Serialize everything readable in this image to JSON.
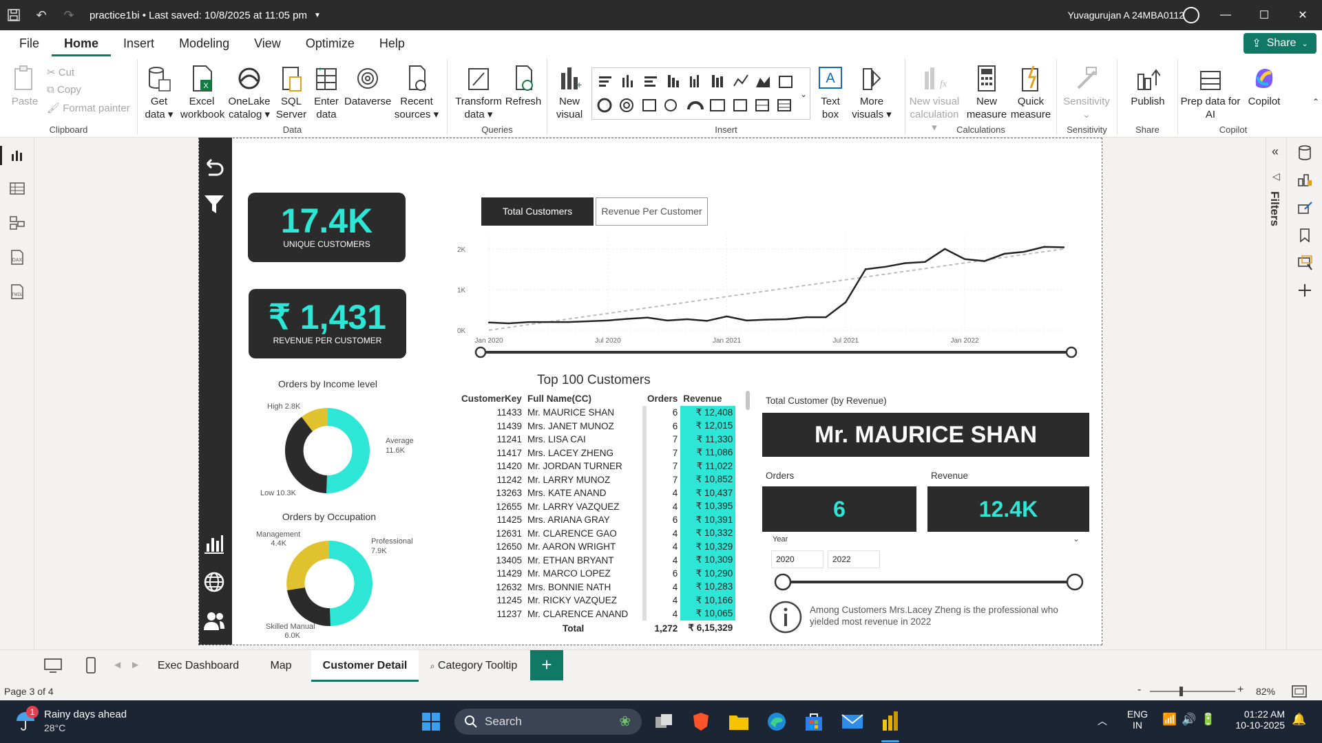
{
  "titlebar": {
    "title": "practice1bi • Last saved: 10/8/2025 at 11:05 pm",
    "user": "Yuvagurujan A 24MBA0112"
  },
  "menu": {
    "tabs": [
      "File",
      "Home",
      "Insert",
      "Modeling",
      "View",
      "Optimize",
      "Help"
    ],
    "active": "Home",
    "share": "Share"
  },
  "ribbon": {
    "clipboard": {
      "paste": "Paste",
      "cut": "Cut",
      "copy": "Copy",
      "format_painter": "Format painter",
      "group": "Clipboard"
    },
    "data": {
      "get_data": "Get data",
      "excel": "Excel workbook",
      "onelake": "OneLake catalog",
      "sql": "SQL Server",
      "enter": "Enter data",
      "dataverse": "Dataverse",
      "recent": "Recent sources",
      "group": "Data"
    },
    "queries": {
      "transform": "Transform data",
      "refresh": "Refresh",
      "group": "Queries"
    },
    "insert": {
      "new_visual": "New visual",
      "text_box": "Text box",
      "more_visuals": "More visuals",
      "group": "Insert"
    },
    "calculations": {
      "new_visual_calc": "New visual calculation",
      "new_measure": "New measure",
      "quick_measure": "Quick measure",
      "group": "Calculations"
    },
    "sensitivity": {
      "label": "Sensitivity",
      "group": "Sensitivity"
    },
    "share": {
      "publish": "Publish",
      "group": "Share"
    },
    "copilot": {
      "prep": "Prep data for AI",
      "copilot": "Copilot",
      "group": "Copilot"
    }
  },
  "report": {
    "kpi1": {
      "value": "17.4K",
      "label": "UNIQUE CUSTOMERS"
    },
    "kpi2": {
      "value": "₹ 1,431",
      "label": "REVENUE PER CUSTOMER"
    },
    "donut1": {
      "title": "Orders by Income level",
      "labels": [
        "High 2.8K",
        "Average",
        "11.6K",
        "Low 10.3K"
      ]
    },
    "donut2": {
      "title": "Orders by Occupation",
      "labels": [
        "Management",
        "4.4K",
        "Professional",
        "7.9K",
        "Skilled Manual",
        "6.0K"
      ]
    },
    "toggle": {
      "btn1": "Total Customers",
      "btn2": "Revenue Per Customer"
    },
    "table": {
      "title": "Top 100 Customers",
      "headers": [
        "CustomerKey",
        "Full Name(CC)",
        "Orders",
        "Revenue"
      ],
      "rows": [
        [
          "11433",
          "Mr. MAURICE SHAN",
          "6",
          "₹ 12,408"
        ],
        [
          "11439",
          "Mrs. JANET MUNOZ",
          "6",
          "₹ 12,015"
        ],
        [
          "11241",
          "Mrs. LISA CAI",
          "7",
          "₹ 11,330"
        ],
        [
          "11417",
          "Mrs. LACEY ZHENG",
          "7",
          "₹ 11,086"
        ],
        [
          "11420",
          "Mr. JORDAN TURNER",
          "7",
          "₹ 11,022"
        ],
        [
          "11242",
          "Mr. LARRY MUNOZ",
          "7",
          "₹ 10,852"
        ],
        [
          "13263",
          "Mrs. KATE ANAND",
          "4",
          "₹ 10,437"
        ],
        [
          "12655",
          "Mr. LARRY VAZQUEZ",
          "4",
          "₹ 10,395"
        ],
        [
          "11425",
          "Mrs. ARIANA GRAY",
          "6",
          "₹ 10,391"
        ],
        [
          "12631",
          "Mr. CLARENCE GAO",
          "4",
          "₹ 10,332"
        ],
        [
          "12650",
          "Mr. AARON WRIGHT",
          "4",
          "₹ 10,329"
        ],
        [
          "13405",
          "Mr. ETHAN BRYANT",
          "4",
          "₹ 10,309"
        ],
        [
          "11429",
          "Mr. MARCO LOPEZ",
          "6",
          "₹ 10,290"
        ],
        [
          "12632",
          "Mrs. BONNIE NATH",
          "4",
          "₹ 10,283"
        ],
        [
          "11245",
          "Mr. RICKY VAZQUEZ",
          "4",
          "₹ 10,166"
        ],
        [
          "11237",
          "Mr. CLARENCE ANAND",
          "4",
          "₹ 10,065"
        ]
      ],
      "total": [
        "Total",
        "1,272",
        "₹ 6,15,329"
      ]
    },
    "detail": {
      "header": "Total Customer (by Revenue)",
      "name": "Mr. MAURICE SHAN",
      "orders_label": "Orders",
      "orders": "6",
      "revenue_label": "Revenue",
      "revenue": "12.4K",
      "year_label": "Year",
      "year_from": "2020",
      "year_to": "2022",
      "insight": "Among Customers Mrs.Lacey Zheng is the professional who yielded most revenue in 2022"
    }
  },
  "chart_data": {
    "type": "line",
    "x": [
      "Jan 2020",
      "Feb 2020",
      "Mar 2020",
      "Apr 2020",
      "May 2020",
      "Jun 2020",
      "Jul 2020",
      "Aug 2020",
      "Sep 2020",
      "Oct 2020",
      "Nov 2020",
      "Dec 2020",
      "Jan 2021",
      "Feb 2021",
      "Mar 2021",
      "Apr 2021",
      "May 2021",
      "Jun 2021",
      "Jul 2021",
      "Aug 2021",
      "Sep 2021",
      "Oct 2021",
      "Nov 2021",
      "Dec 2021",
      "Jan 2022",
      "Feb 2022",
      "Mar 2022",
      "Apr 2022",
      "May 2022",
      "Jun 2022"
    ],
    "values": [
      190,
      170,
      200,
      200,
      200,
      220,
      240,
      280,
      310,
      240,
      270,
      230,
      340,
      240,
      260,
      270,
      320,
      320,
      690,
      1500,
      1560,
      1650,
      1680,
      2000,
      1750,
      1700,
      1880,
      1930,
      2050,
      2040
    ],
    "trend": [
      0,
      2000
    ],
    "x_ticks": [
      "Jan 2020",
      "Jul 2020",
      "Jan 2021",
      "Jul 2021",
      "Jan 2022"
    ],
    "y_ticks": [
      "0K",
      "1K",
      "2K"
    ],
    "ylim": [
      0,
      2200
    ]
  },
  "tabs": {
    "pages": [
      "Exec Dashboard",
      "Map",
      "Customer Detail",
      "Category Tooltip"
    ],
    "active": "Customer Detail"
  },
  "status": {
    "page": "Page 3 of 4",
    "zoom": "82%"
  },
  "taskbar": {
    "weather_title": "Rainy days ahead",
    "weather_temp": "28°C",
    "badge": "1",
    "search": "Search",
    "lang1": "ENG",
    "lang2": "IN",
    "time": "01:22 AM",
    "date": "10-10-2025"
  },
  "colors": {
    "accent": "#117865",
    "teal": "#2ee6d6",
    "dark": "#2b2b2b",
    "gold": "#e0c12e"
  }
}
